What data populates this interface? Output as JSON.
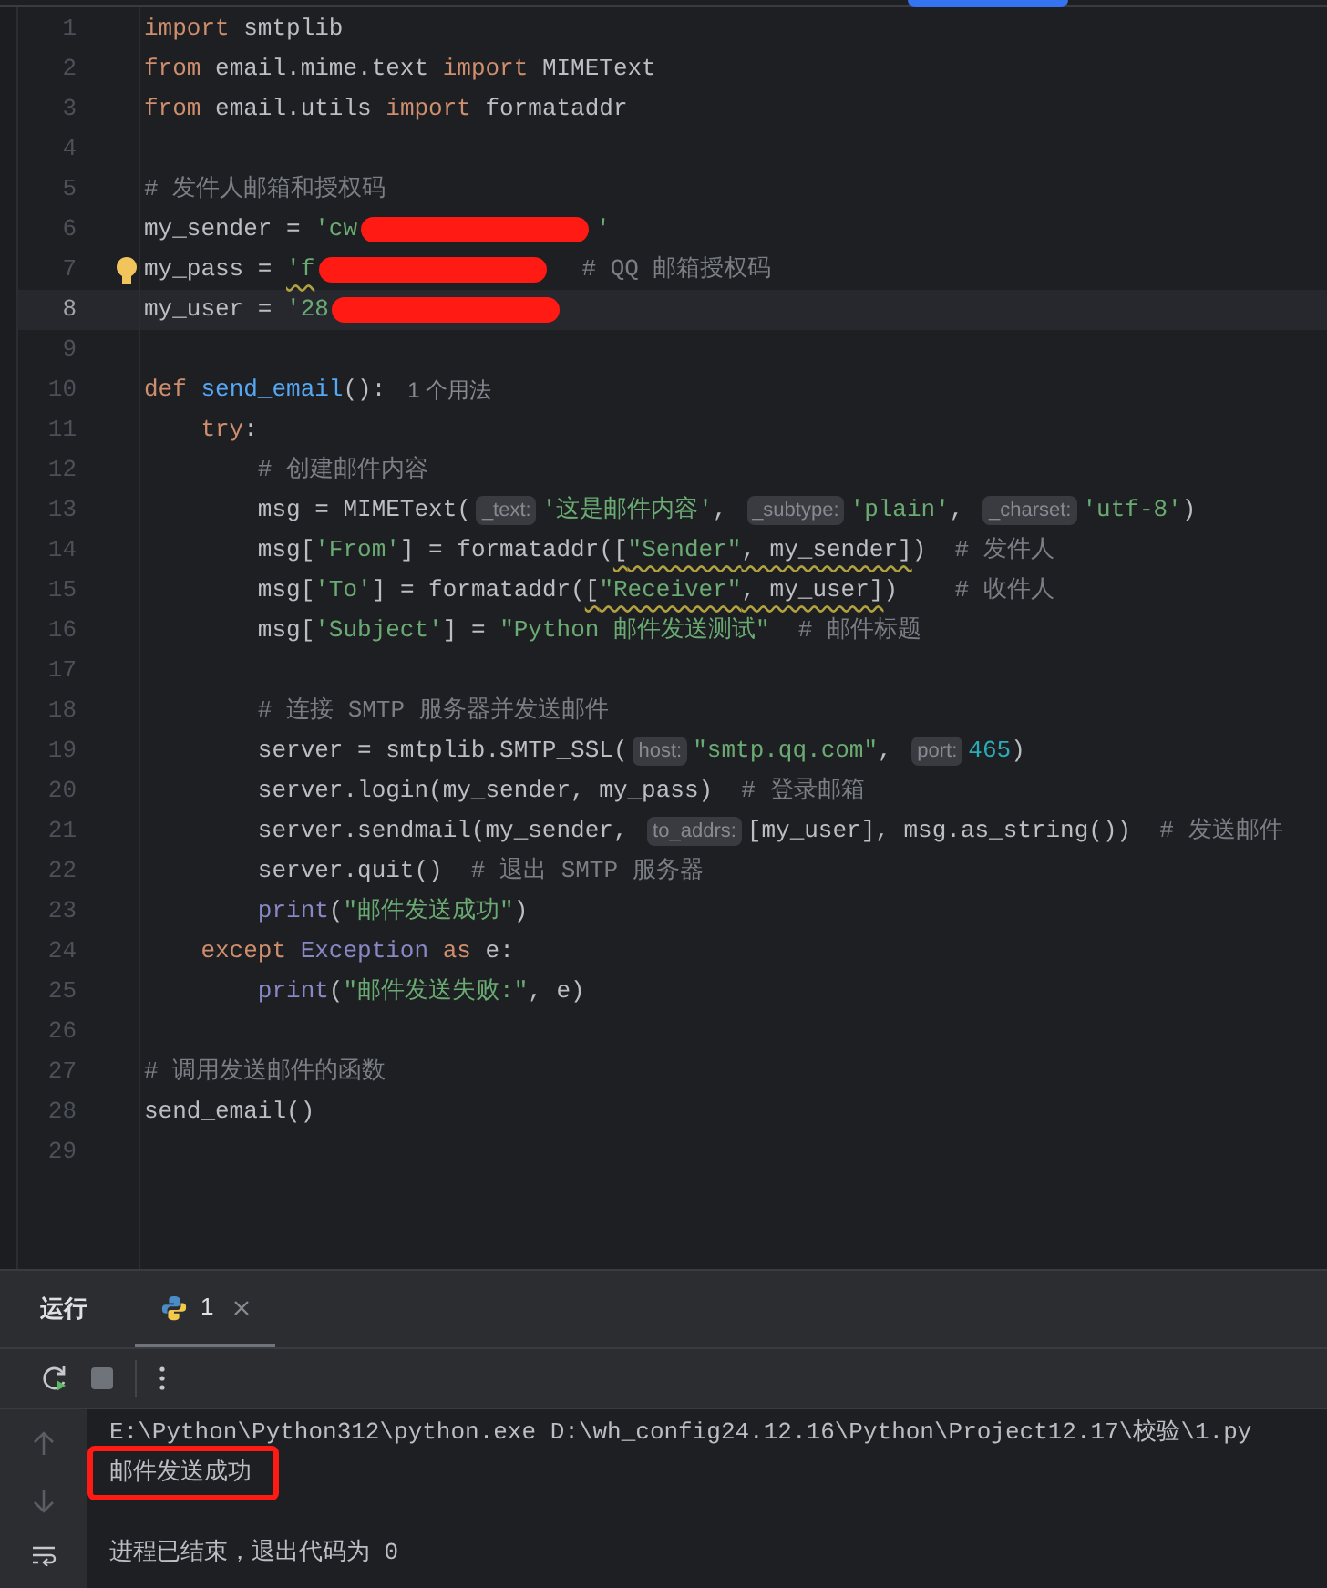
{
  "editor": {
    "lines": [
      {
        "n": "1",
        "current": false,
        "bulb": false,
        "tokens": [
          {
            "kind": "kw",
            "text": "import "
          },
          {
            "kind": "plain",
            "text": "smtplib"
          }
        ]
      },
      {
        "n": "2",
        "current": false,
        "bulb": false,
        "tokens": [
          {
            "kind": "kw",
            "text": "from "
          },
          {
            "kind": "plain",
            "text": "email.mime.text "
          },
          {
            "kind": "kw",
            "text": "import "
          },
          {
            "kind": "plain",
            "text": "MIMEText"
          }
        ]
      },
      {
        "n": "3",
        "current": false,
        "bulb": false,
        "tokens": [
          {
            "kind": "kw",
            "text": "from "
          },
          {
            "kind": "plain",
            "text": "email.utils "
          },
          {
            "kind": "kw",
            "text": "import "
          },
          {
            "kind": "plain",
            "text": "formataddr"
          }
        ]
      },
      {
        "n": "4",
        "current": false,
        "bulb": false
      },
      {
        "n": "5",
        "current": false,
        "bulb": false,
        "tokens": [
          {
            "kind": "cmt",
            "text": "# 发件人邮箱和授权码"
          }
        ]
      },
      {
        "n": "6",
        "current": false,
        "bulb": false,
        "tokens": [
          {
            "kind": "plain",
            "text": "my_sender = "
          },
          {
            "kind": "str",
            "text": "'cw"
          },
          {
            "kind": "redaction"
          },
          {
            "kind": "str",
            "text": "'"
          }
        ]
      },
      {
        "n": "7",
        "current": false,
        "bulb": true,
        "tokens": [
          {
            "kind": "plain",
            "text": "my_pass = "
          },
          {
            "kind": "str",
            "text": "'f",
            "warn": true
          },
          {
            "kind": "redaction"
          },
          {
            "kind": "cmt",
            "text": "  # QQ 邮箱授权码"
          }
        ]
      },
      {
        "n": "8",
        "current": true,
        "bulb": false,
        "tokens": [
          {
            "kind": "plain",
            "text": "my_user = "
          },
          {
            "kind": "str",
            "text": "'28"
          },
          {
            "kind": "redaction"
          }
        ]
      },
      {
        "n": "9",
        "current": false,
        "bulb": false
      },
      {
        "n": "10",
        "current": false,
        "bulb": false,
        "tokens": [
          {
            "kind": "kw",
            "text": "def "
          },
          {
            "kind": "fn",
            "text": "send_email"
          },
          {
            "kind": "plain",
            "text": "():"
          },
          {
            "kind": "usage",
            "text": "1 个用法"
          }
        ]
      },
      {
        "n": "11",
        "current": false,
        "bulb": false,
        "tokens": [
          {
            "kind": "kw",
            "text": "    try"
          },
          {
            "kind": "plain",
            "text": ":"
          }
        ]
      },
      {
        "n": "12",
        "current": false,
        "bulb": false,
        "tokens": [
          {
            "kind": "cmt",
            "text": "        # 创建邮件内容"
          }
        ]
      },
      {
        "n": "13",
        "current": false,
        "bulb": false,
        "tokens": [
          {
            "kind": "plain",
            "text": "        msg = MIMEText("
          },
          {
            "kind": "hint",
            "text": "_text:"
          },
          {
            "kind": "str",
            "text": "'这是邮件内容'"
          },
          {
            "kind": "plain",
            "text": ", "
          },
          {
            "kind": "hint",
            "text": "_subtype:"
          },
          {
            "kind": "str",
            "text": "'plain'"
          },
          {
            "kind": "plain",
            "text": ", "
          },
          {
            "kind": "hint",
            "text": "_charset:"
          },
          {
            "kind": "str",
            "text": "'utf-8'"
          },
          {
            "kind": "plain",
            "text": ")"
          }
        ]
      },
      {
        "n": "14",
        "current": false,
        "bulb": false,
        "tokens": [
          {
            "kind": "plain",
            "text": "        msg["
          },
          {
            "kind": "str",
            "text": "'From'"
          },
          {
            "kind": "plain",
            "text": "] = formataddr("
          },
          {
            "kind": "plain",
            "text": "[",
            "warn": true
          },
          {
            "kind": "str",
            "text": "\"Sender\"",
            "warn": true
          },
          {
            "kind": "plain",
            "text": ", my_sender]",
            "warn": true
          },
          {
            "kind": "plain",
            "text": ")"
          },
          {
            "kind": "cmt",
            "text": "  # 发件人"
          }
        ]
      },
      {
        "n": "15",
        "current": false,
        "bulb": false,
        "tokens": [
          {
            "kind": "plain",
            "text": "        msg["
          },
          {
            "kind": "str",
            "text": "'To'"
          },
          {
            "kind": "plain",
            "text": "] = formataddr("
          },
          {
            "kind": "plain",
            "text": "[",
            "warn": true
          },
          {
            "kind": "str",
            "text": "\"Receiver\"",
            "warn": true
          },
          {
            "kind": "plain",
            "text": ", my_user]",
            "warn": true
          },
          {
            "kind": "plain",
            "text": ")"
          },
          {
            "kind": "cmt",
            "text": "    # 收件人"
          }
        ]
      },
      {
        "n": "16",
        "current": false,
        "bulb": false,
        "tokens": [
          {
            "kind": "plain",
            "text": "        msg["
          },
          {
            "kind": "str",
            "text": "'Subject'"
          },
          {
            "kind": "plain",
            "text": "] = "
          },
          {
            "kind": "str",
            "text": "\"Python 邮件发送测试\""
          },
          {
            "kind": "cmt",
            "text": "  # 邮件标题"
          }
        ]
      },
      {
        "n": "17",
        "current": false,
        "bulb": false
      },
      {
        "n": "18",
        "current": false,
        "bulb": false,
        "tokens": [
          {
            "kind": "cmt",
            "text": "        # 连接 SMTP 服务器并发送邮件"
          }
        ]
      },
      {
        "n": "19",
        "current": false,
        "bulb": false,
        "tokens": [
          {
            "kind": "plain",
            "text": "        server = smtplib.SMTP_SSL("
          },
          {
            "kind": "hint",
            "text": "host:"
          },
          {
            "kind": "str",
            "text": "\"smtp.qq.com\""
          },
          {
            "kind": "plain",
            "text": ", "
          },
          {
            "kind": "hint",
            "text": "port:"
          },
          {
            "kind": "num",
            "text": "465"
          },
          {
            "kind": "plain",
            "text": ")"
          }
        ]
      },
      {
        "n": "20",
        "current": false,
        "bulb": false,
        "tokens": [
          {
            "kind": "plain",
            "text": "        server.login(my_sender, my_pass)"
          },
          {
            "kind": "cmt",
            "text": "  # 登录邮箱"
          }
        ]
      },
      {
        "n": "21",
        "current": false,
        "bulb": false,
        "tokens": [
          {
            "kind": "plain",
            "text": "        server.sendmail(my_sender, "
          },
          {
            "kind": "hint",
            "text": "to_addrs:"
          },
          {
            "kind": "plain",
            "text": "[my_user], msg.as_string())"
          },
          {
            "kind": "cmt",
            "text": "  # 发送邮件"
          }
        ]
      },
      {
        "n": "22",
        "current": false,
        "bulb": false,
        "tokens": [
          {
            "kind": "plain",
            "text": "        server.quit()"
          },
          {
            "kind": "cmt",
            "text": "  # 退出 SMTP 服务器"
          }
        ]
      },
      {
        "n": "23",
        "current": false,
        "bulb": false,
        "tokens": [
          {
            "kind": "builtin",
            "text": "        print"
          },
          {
            "kind": "plain",
            "text": "("
          },
          {
            "kind": "str",
            "text": "\"邮件发送成功\""
          },
          {
            "kind": "plain",
            "text": ")"
          }
        ]
      },
      {
        "n": "24",
        "current": false,
        "bulb": false,
        "tokens": [
          {
            "kind": "kw",
            "text": "    except "
          },
          {
            "kind": "builtin",
            "text": "Exception"
          },
          {
            "kind": "kw",
            "text": " as "
          },
          {
            "kind": "plain",
            "text": "e:"
          }
        ]
      },
      {
        "n": "25",
        "current": false,
        "bulb": false,
        "tokens": [
          {
            "kind": "builtin",
            "text": "        print"
          },
          {
            "kind": "plain",
            "text": "("
          },
          {
            "kind": "str",
            "text": "\"邮件发送失败:\""
          },
          {
            "kind": "plain",
            "text": ", e)"
          }
        ]
      },
      {
        "n": "26",
        "current": false,
        "bulb": false
      },
      {
        "n": "27",
        "current": false,
        "bulb": false,
        "tokens": [
          {
            "kind": "cmt",
            "text": "# 调用发送邮件的函数"
          }
        ]
      },
      {
        "n": "28",
        "current": false,
        "bulb": false,
        "tokens": [
          {
            "kind": "plain",
            "text": "send_email()"
          }
        ]
      },
      {
        "n": "29",
        "current": false,
        "bulb": false
      }
    ]
  },
  "run_panel": {
    "title": "运行",
    "tabs": [
      {
        "label": "1",
        "selected": true
      }
    ],
    "output": [
      {
        "text": "E:\\Python\\Python312\\python.exe D:\\wh_config24.12.16\\Python\\Project12.17\\校验\\1.py",
        "framed": false
      },
      {
        "text": "邮件发送成功",
        "framed": true
      },
      {
        "framed": false
      },
      {
        "text": "进程已结束，退出代码为 0",
        "framed": false
      }
    ]
  }
}
